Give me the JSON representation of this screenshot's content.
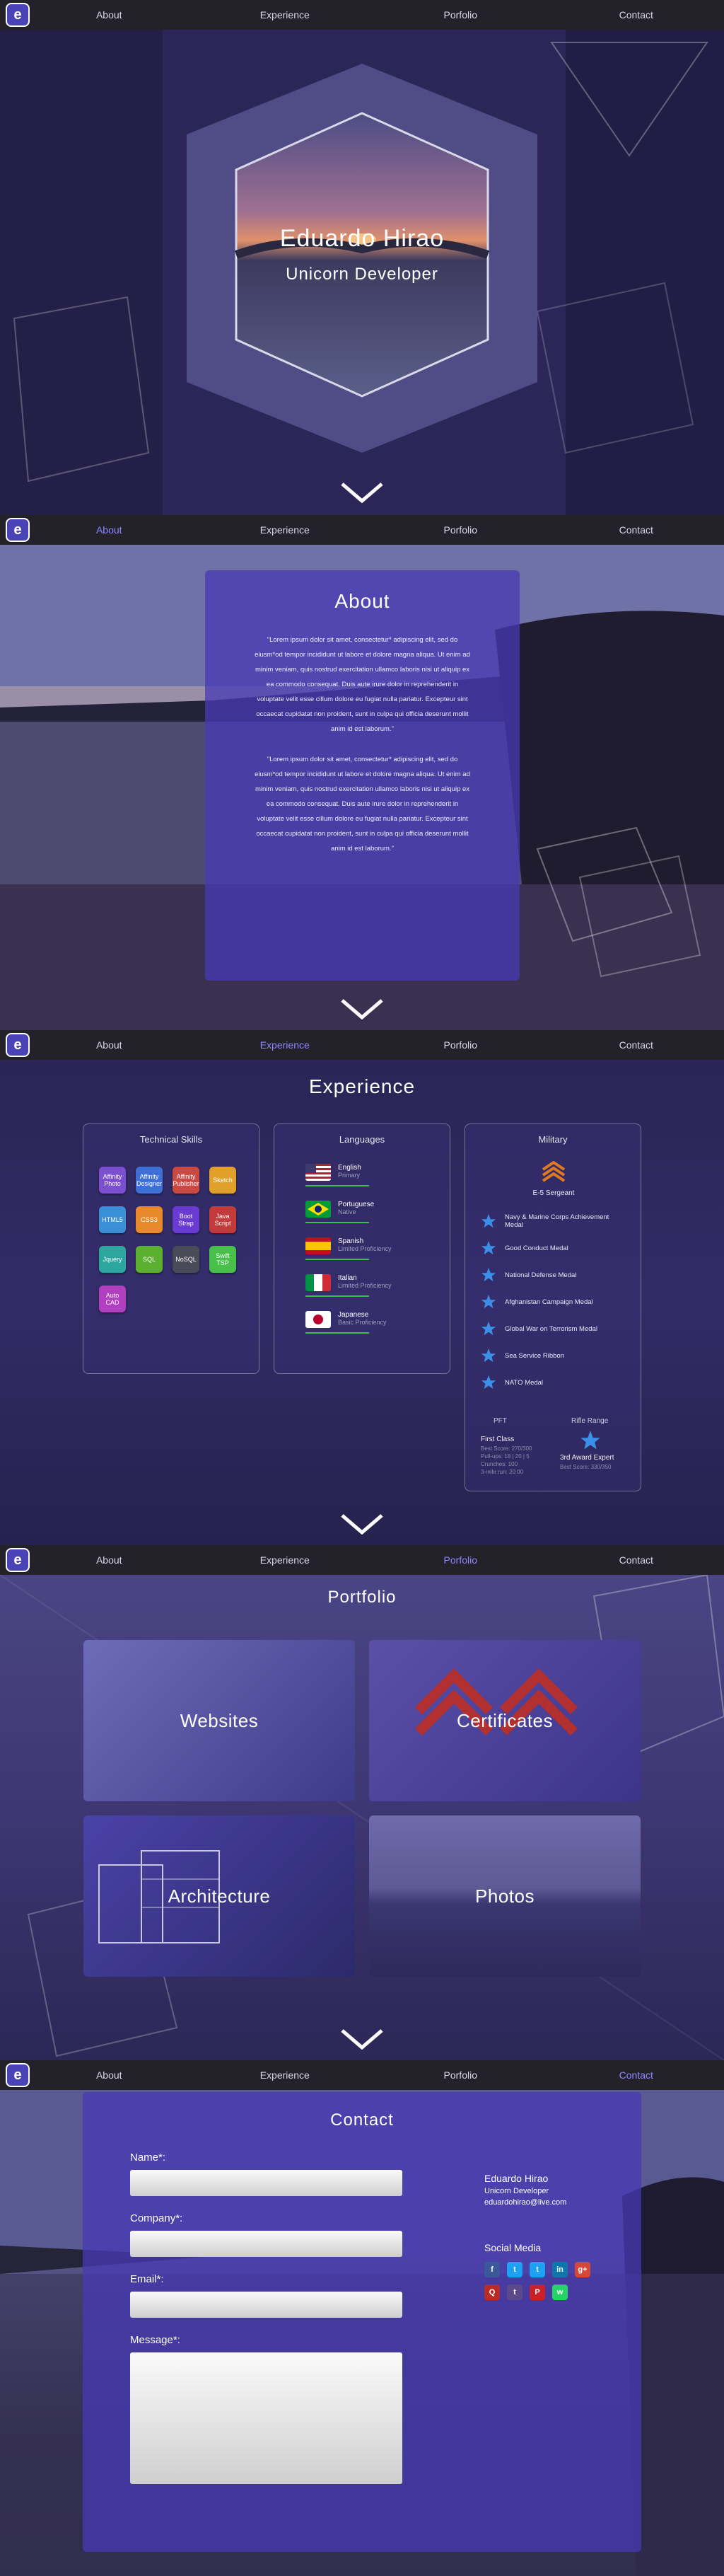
{
  "nav": {
    "logo": "e",
    "items": [
      "About",
      "Experience",
      "Porfolio",
      "Contact"
    ]
  },
  "hero": {
    "name": "Eduardo Hirao",
    "title": "Unicorn Developer"
  },
  "about": {
    "heading": "About",
    "paragraph1": "\"Lorem ipsum dolor sit amet, consectetur* adipiscing elit, sed do eiusm*od tempor incididunt ut labore et dolore magna aliqua. Ut enim ad minim veniam, quis nostrud exercitation ullamco laboris nisi ut aliquip ex ea commodo consequat. Duis aute irure dolor in reprehenderit in voluptate velit esse cillum dolore eu fugiat nulla pariatur. Excepteur sint occaecat cupidatat non proident, sunt in culpa qui officia deserunt mollit anim id est laborum.\"",
    "paragraph2": "\"Lorem ipsum dolor sit amet, consectetur* adipiscing elit, sed do eiusm*od tempor incididunt ut labore et dolore magna aliqua. Ut enim ad minim veniam, quis nostrud exercitation ullamco laboris nisi ut aliquip ex ea commodo consequat. Duis aute irure dolor in reprehenderit in voluptate velit esse cillum dolore eu fugiat nulla pariatur. Excepteur sint occaecat cupidatat non proident, sunt in culpa qui officia deserunt mollit anim id est laborum.\""
  },
  "experience": {
    "heading": "Experience",
    "skills_title": "Technical Skills",
    "skills": [
      {
        "label": "Affinity Photo",
        "color": "#7b4fd0"
      },
      {
        "label": "Affinity Designer",
        "color": "#3d6fd6"
      },
      {
        "label": "Affinity Publisher",
        "color": "#c94a43"
      },
      {
        "label": "Sketch",
        "color": "#e0a02a"
      },
      {
        "label": "HTML5",
        "color": "#3b8fd6"
      },
      {
        "label": "CSS3",
        "color": "#e88a2c"
      },
      {
        "label": "Boot Strap",
        "color": "#6a3bd0"
      },
      {
        "label": "Java Script",
        "color": "#c23a3a"
      },
      {
        "label": "Jquery",
        "color": "#2ea6a0"
      },
      {
        "label": "SQL",
        "color": "#5bb030"
      },
      {
        "label": "NoSQL",
        "color": "#4a4a58"
      },
      {
        "label": "Swift TSP",
        "color": "#48c04a"
      },
      {
        "label": "Auto CAD",
        "color": "#b040c0"
      }
    ],
    "languages_title": "Languages",
    "languages": [
      {
        "name": "English",
        "level": "Primary",
        "flag": "us"
      },
      {
        "name": "Portuguese",
        "level": "Native",
        "flag": "br"
      },
      {
        "name": "Spanish",
        "level": "Limited Proficiency",
        "flag": "es"
      },
      {
        "name": "Italian",
        "level": "Limited Proficiency",
        "flag": "it"
      },
      {
        "name": "Japanese",
        "level": "Basic Proficiency",
        "flag": "jp"
      }
    ],
    "military_title": "Military",
    "rank": "E-5 Sergeant",
    "medals": [
      "Navy & Marine Corps Achievement Medal",
      "Good Conduct Medal",
      "National Defense Medal",
      "Afghanistan Campaign Medal",
      "Global War on Terrorism Medal",
      "Sea Service Ribbon",
      "NATO Medal"
    ],
    "pft_label": "PFT",
    "pft_value": "First Class",
    "pft_details": [
      "Best Score: 270/300",
      "Pull-ups: 18 | 20 | 5",
      "Crunches: 100",
      "3-mile run: 20:00"
    ],
    "rifle_label": "Rifle Range",
    "rifle_value": "3rd Award Expert",
    "rifle_detail": "Best Score: 330/350"
  },
  "portfolio": {
    "heading": "Portfolio",
    "tiles": [
      "Websites",
      "Certificates",
      "Architecture",
      "Photos"
    ]
  },
  "contact": {
    "heading": "Contact",
    "name_label": "Name*:",
    "company_label": "Company*:",
    "email_label": "Email*:",
    "message_label": "Message*:",
    "info_name": "Eduardo Hirao",
    "info_title": "Unicorn Developer",
    "info_email": "eduardohirao@live.com",
    "social_title": "Social Media",
    "social": [
      {
        "icon": "facebook-icon",
        "glyph": "f",
        "color": "#3b5998"
      },
      {
        "icon": "twitter-icon",
        "glyph": "t",
        "color": "#1da1f2"
      },
      {
        "icon": "twitter-alt-icon",
        "glyph": "t",
        "color": "#1da1f2"
      },
      {
        "icon": "linkedin-icon",
        "glyph": "in",
        "color": "#0e76a8"
      },
      {
        "icon": "google-plus-icon",
        "glyph": "g+",
        "color": "#d34836"
      },
      {
        "icon": "quora-icon",
        "glyph": "Q",
        "color": "#b92b27"
      },
      {
        "icon": "tumblr-icon",
        "glyph": "t",
        "color": "#5b4a8a"
      },
      {
        "icon": "pinterest-icon",
        "glyph": "P",
        "color": "#cb2027"
      },
      {
        "icon": "whatsapp-icon",
        "glyph": "w",
        "color": "#25d366"
      }
    ]
  }
}
